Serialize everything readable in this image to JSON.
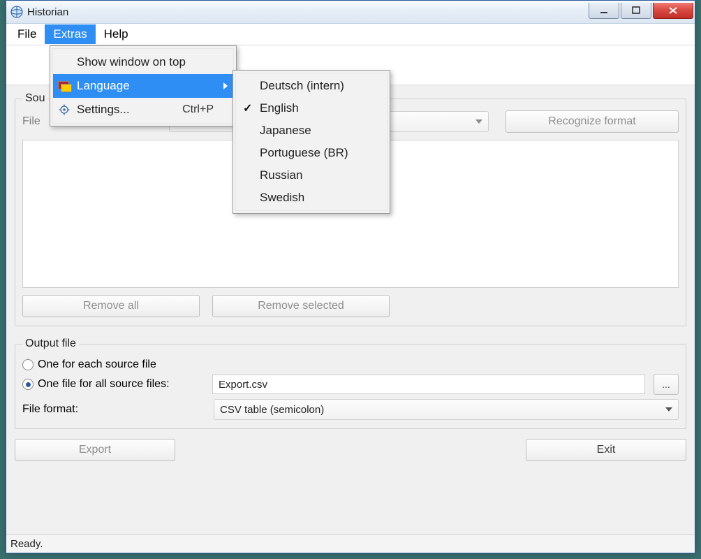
{
  "window": {
    "title": "Historian"
  },
  "menubar": {
    "file": "File",
    "extras": "Extras",
    "help": "Help"
  },
  "extras_menu": {
    "show_on_top": "Show window on top",
    "language": "Language",
    "settings": "Settings...",
    "settings_shortcut": "Ctrl+P"
  },
  "languages": {
    "items": [
      {
        "label": "Deutsch (intern)",
        "checked": false
      },
      {
        "label": "English",
        "checked": true
      },
      {
        "label": "Japanese",
        "checked": false
      },
      {
        "label": "Portuguese (BR)",
        "checked": false
      },
      {
        "label": "Russian",
        "checked": false
      },
      {
        "label": "Swedish",
        "checked": false
      }
    ]
  },
  "source": {
    "legend_partial": "Sou",
    "file_label_partial": "File",
    "format_combo": "",
    "recognize_btn": "Recognize format",
    "remove_all": "Remove all",
    "remove_selected": "Remove selected"
  },
  "output": {
    "legend": "Output file",
    "opt_each": "One for each source file",
    "opt_all": "One file for all source files:",
    "filename": "Export.csv",
    "browse": "...",
    "format_label": "File format:",
    "format_value": "CSV table (semicolon)"
  },
  "footer": {
    "export": "Export",
    "exit": "Exit"
  },
  "status": {
    "text": "Ready."
  }
}
